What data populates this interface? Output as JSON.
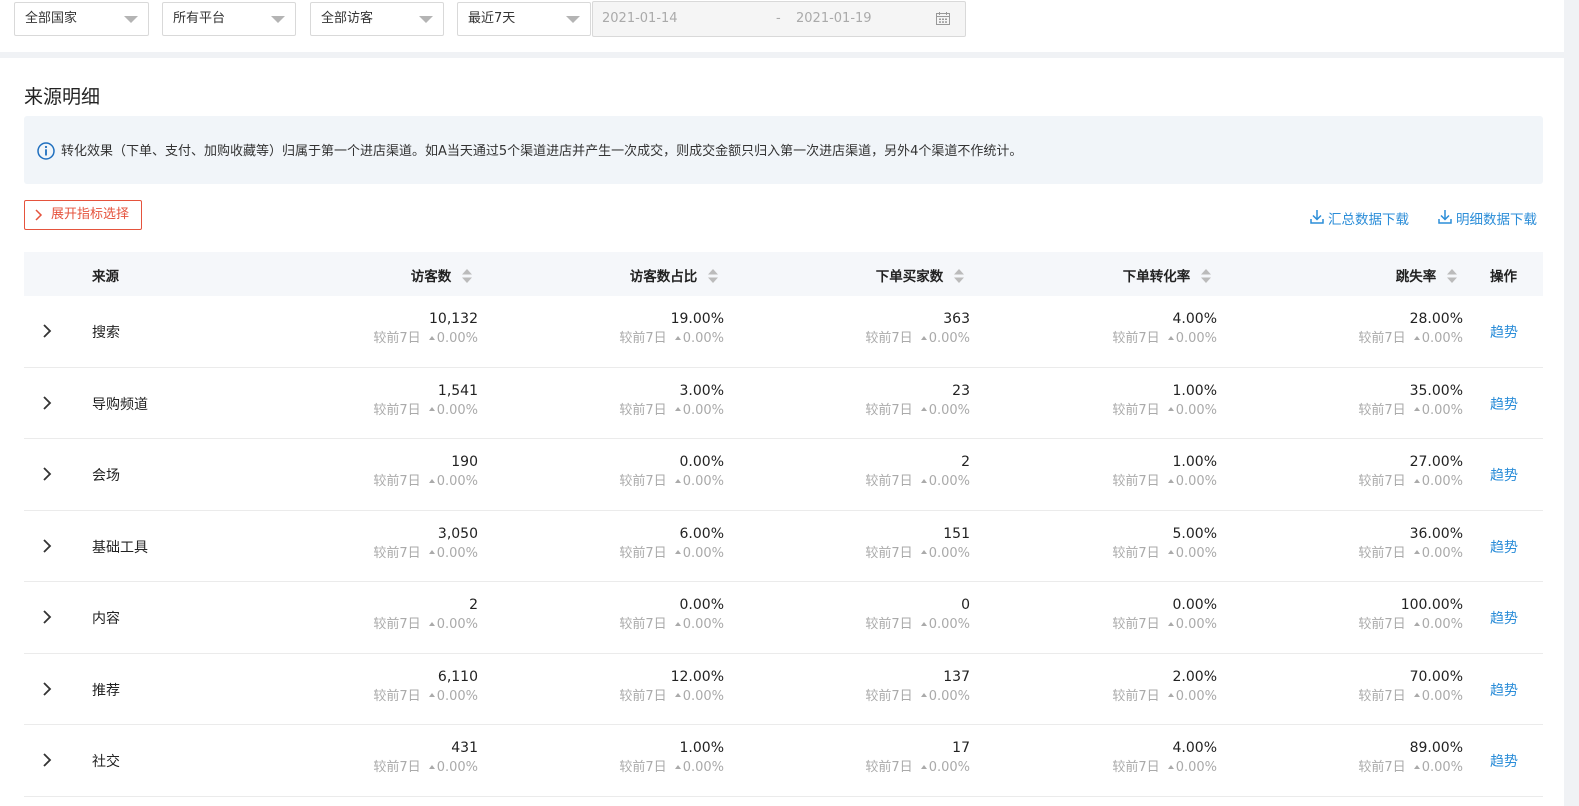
{
  "filters": {
    "country": "全部国家",
    "platform": "所有平台",
    "visitor": "全部访客",
    "period": "最近7天",
    "date_start": "2021-01-14",
    "date_sep": "-",
    "date_end": "2021-01-19"
  },
  "panel": {
    "title": "来源明细",
    "notice": "转化效果（下单、支付、加购收藏等）归属于第一个进店渠道。如A当天通过5个渠道进店并产生一次成交，则成交金额只归入第一次进店渠道，另外4个渠道不作统计。",
    "expand_label": "展开指标选择",
    "download_summary": "汇总数据下载",
    "download_detail": "明细数据下载"
  },
  "table": {
    "headers": {
      "source": "来源",
      "visitors": "访客数",
      "visitor_ratio": "访客数占比",
      "buyers": "下单买家数",
      "conversion": "下单转化率",
      "bounce": "跳失率",
      "action": "操作"
    },
    "compare_label": "较前7日",
    "compare_value": "0.00%",
    "trend_label": "趋势",
    "rows": [
      {
        "source": "搜索",
        "visitors": "10,132",
        "visitor_ratio": "19.00%",
        "buyers": "363",
        "conversion": "4.00%",
        "bounce": "28.00%"
      },
      {
        "source": "导购频道",
        "visitors": "1,541",
        "visitor_ratio": "3.00%",
        "buyers": "23",
        "conversion": "1.00%",
        "bounce": "35.00%"
      },
      {
        "source": "会场",
        "visitors": "190",
        "visitor_ratio": "0.00%",
        "buyers": "2",
        "conversion": "1.00%",
        "bounce": "27.00%"
      },
      {
        "source": "基础工具",
        "visitors": "3,050",
        "visitor_ratio": "6.00%",
        "buyers": "151",
        "conversion": "5.00%",
        "bounce": "36.00%"
      },
      {
        "source": "内容",
        "visitors": "2",
        "visitor_ratio": "0.00%",
        "buyers": "0",
        "conversion": "0.00%",
        "bounce": "100.00%"
      },
      {
        "source": "推荐",
        "visitors": "6,110",
        "visitor_ratio": "12.00%",
        "buyers": "137",
        "conversion": "2.00%",
        "bounce": "70.00%"
      },
      {
        "source": "社交",
        "visitors": "431",
        "visitor_ratio": "1.00%",
        "buyers": "17",
        "conversion": "4.00%",
        "bounce": "89.00%"
      }
    ]
  }
}
